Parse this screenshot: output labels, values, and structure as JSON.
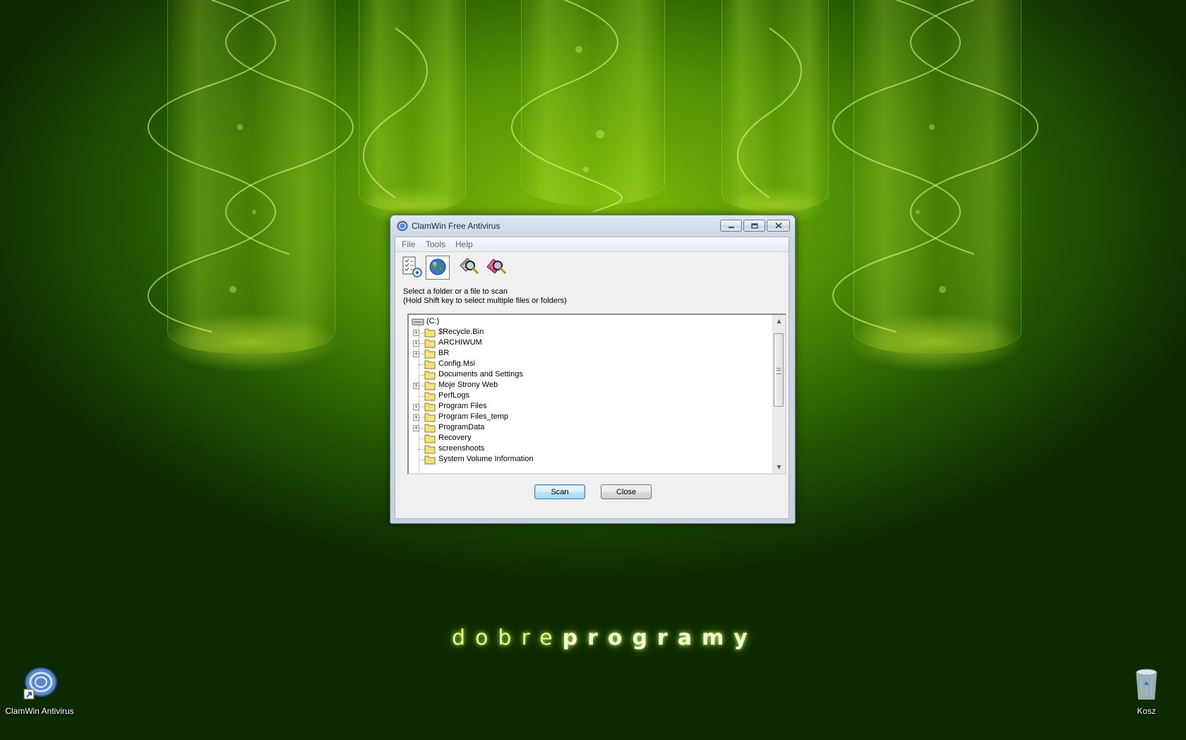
{
  "desktop": {
    "brand": {
      "part1": "dobre",
      "part2": "programy"
    },
    "icons": [
      {
        "label": "ClamWin Antivirus",
        "icon": "clamwin-shortcut-icon"
      },
      {
        "label": "Kosz",
        "icon": "recycle-bin-icon"
      }
    ]
  },
  "window": {
    "title": "ClamWin Free Antivirus",
    "controls": {
      "minimize": "—",
      "maximize": "▭",
      "close": "✕"
    },
    "menu": [
      "File",
      "Tools",
      "Help"
    ],
    "toolbar": [
      {
        "name": "preferences-tool-button",
        "icon": "checklist-preferences-icon"
      },
      {
        "name": "update-database-tool-button",
        "icon": "globe-update-icon",
        "pressed": true
      },
      {
        "name": "scan-memory-tool-button",
        "icon": "scan-memory-icon"
      },
      {
        "name": "scheduled-scan-tool-button",
        "icon": "scan-magnifier-icon"
      }
    ],
    "instruction": {
      "line1": "Select a folder or a file to scan",
      "line2": "(Hold Shift key to select multiple files or folders)"
    },
    "tree": {
      "root": "(C:)",
      "items": [
        {
          "label": "$Recycle.Bin",
          "expandable": true
        },
        {
          "label": "ARCHIWUM",
          "expandable": true
        },
        {
          "label": "BR",
          "expandable": true
        },
        {
          "label": "Config.Msi",
          "expandable": false
        },
        {
          "label": "Documents and Settings",
          "expandable": false
        },
        {
          "label": "Moje Strony Web",
          "expandable": true
        },
        {
          "label": "PerfLogs",
          "expandable": false
        },
        {
          "label": "Program Files",
          "expandable": true
        },
        {
          "label": "Program Files_temp",
          "expandable": true
        },
        {
          "label": "ProgramData",
          "expandable": true
        },
        {
          "label": "Recovery",
          "expandable": false
        },
        {
          "label": "screenshoots",
          "expandable": false
        },
        {
          "label": "System Volume Information",
          "expandable": false
        }
      ]
    },
    "buttons": {
      "scan": "Scan",
      "close": "Close"
    }
  }
}
